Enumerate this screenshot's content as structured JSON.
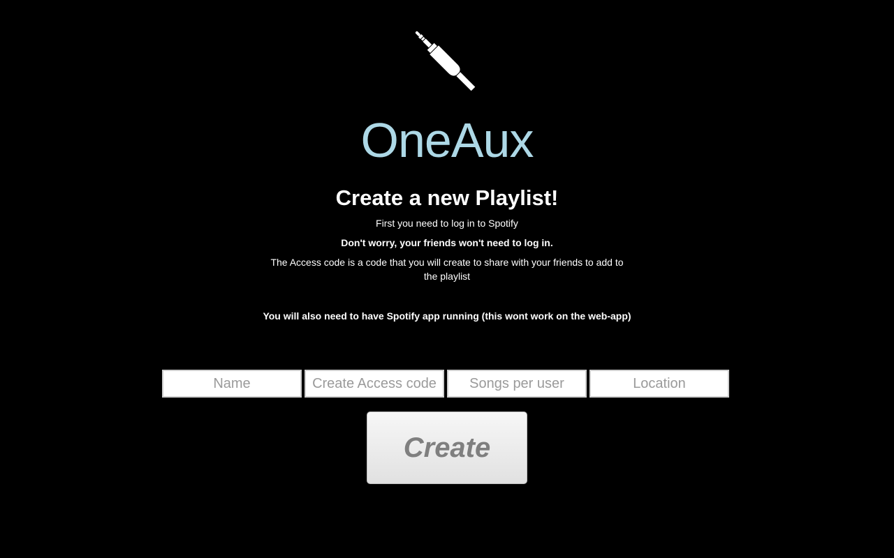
{
  "logo": {
    "icon": "audio-jack-icon",
    "color": "#ffffff"
  },
  "brand": {
    "title": "OneAux",
    "color": "#add8e6"
  },
  "intro": {
    "heading": "Create a new Playlist!",
    "line1": "First you need to log in to Spotify",
    "line2": "Don't worry, your friends won't need to log in.",
    "line3": "The Access code is a code that you will create to share with your friends to add to the playlist",
    "line4": "You will also need to have Spotify app running (this wont work on the web-app)"
  },
  "form": {
    "name_placeholder": "Name",
    "name_value": "",
    "access_code_placeholder": "Create Access code",
    "access_code_value": "",
    "songs_placeholder": "Songs per user",
    "songs_value": "",
    "location_placeholder": "Location",
    "location_value": "",
    "create_label": "Create"
  }
}
